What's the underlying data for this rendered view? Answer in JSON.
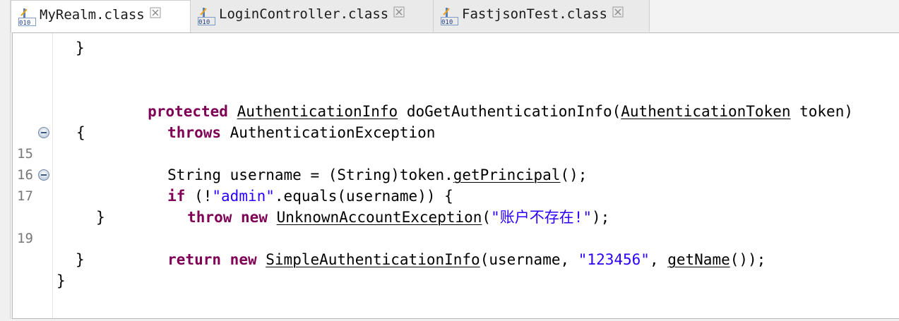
{
  "tabs": [
    {
      "label": "MyRealm.class",
      "active": true,
      "icon": "class-file-icon"
    },
    {
      "label": "LoginController.class",
      "active": false,
      "icon": "class-file-icon"
    },
    {
      "label": "FastjsonTest.class",
      "active": false,
      "icon": "class-file-icon"
    }
  ],
  "editor": {
    "line_numbers": {
      "l15": "15",
      "l16": "16",
      "l17": "17",
      "l19": "19"
    },
    "code": {
      "close_brace_prev": "}",
      "kw_protected": "protected",
      "type_authinfo": "AuthenticationInfo",
      "method_sig": " doGetAuthenticationInfo(",
      "type_authtoken": "AuthenticationToken",
      "param_token": " token)",
      "kw_throws": "throws",
      "exc_type": " AuthenticationException",
      "open_brace": "{",
      "stmt_username_a": "String username = (String)token.",
      "call_getprincipal": "getPrincipal",
      "stmt_username_b": "();",
      "kw_if": "if",
      "if_a": " (!",
      "str_admin": "\"admin\"",
      "if_b": ".equals(username)) {",
      "kw_throw": "throw",
      "kw_new": "new",
      "type_unknown": "UnknownAccountException",
      "throw_a": "(",
      "str_msg": "\"账户不存在!\"",
      "throw_b": ");",
      "close_if": "}",
      "kw_return": "return",
      "type_simpleinfo": "SimpleAuthenticationInfo",
      "ret_a": "(username, ",
      "str_pwd": "\"123456\"",
      "ret_b": ", ",
      "call_getname": "getName",
      "ret_c": "());",
      "close_method": "}",
      "close_class": "}"
    }
  },
  "colors": {
    "keyword": "#7f0055",
    "string": "#2a00ff",
    "line_number": "#787878"
  }
}
